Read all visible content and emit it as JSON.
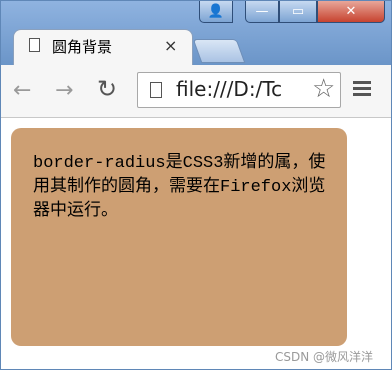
{
  "tab": {
    "title": "圆角背景",
    "close": "×"
  },
  "window_controls": {
    "user": "👤",
    "minimize": "—",
    "maximize": "▭",
    "close": "✕"
  },
  "toolbar": {
    "back": "←",
    "forward": "→",
    "reload": "↻",
    "url": "file:///D:/Tc",
    "bookmark": "☆"
  },
  "content": {
    "text": "border-radius是CSS3新增的属，使用其制作的圆角，需要在Firefox浏览器中运行。",
    "box_color": "#cd9f73"
  },
  "watermark": "CSDN @微风洋洋"
}
